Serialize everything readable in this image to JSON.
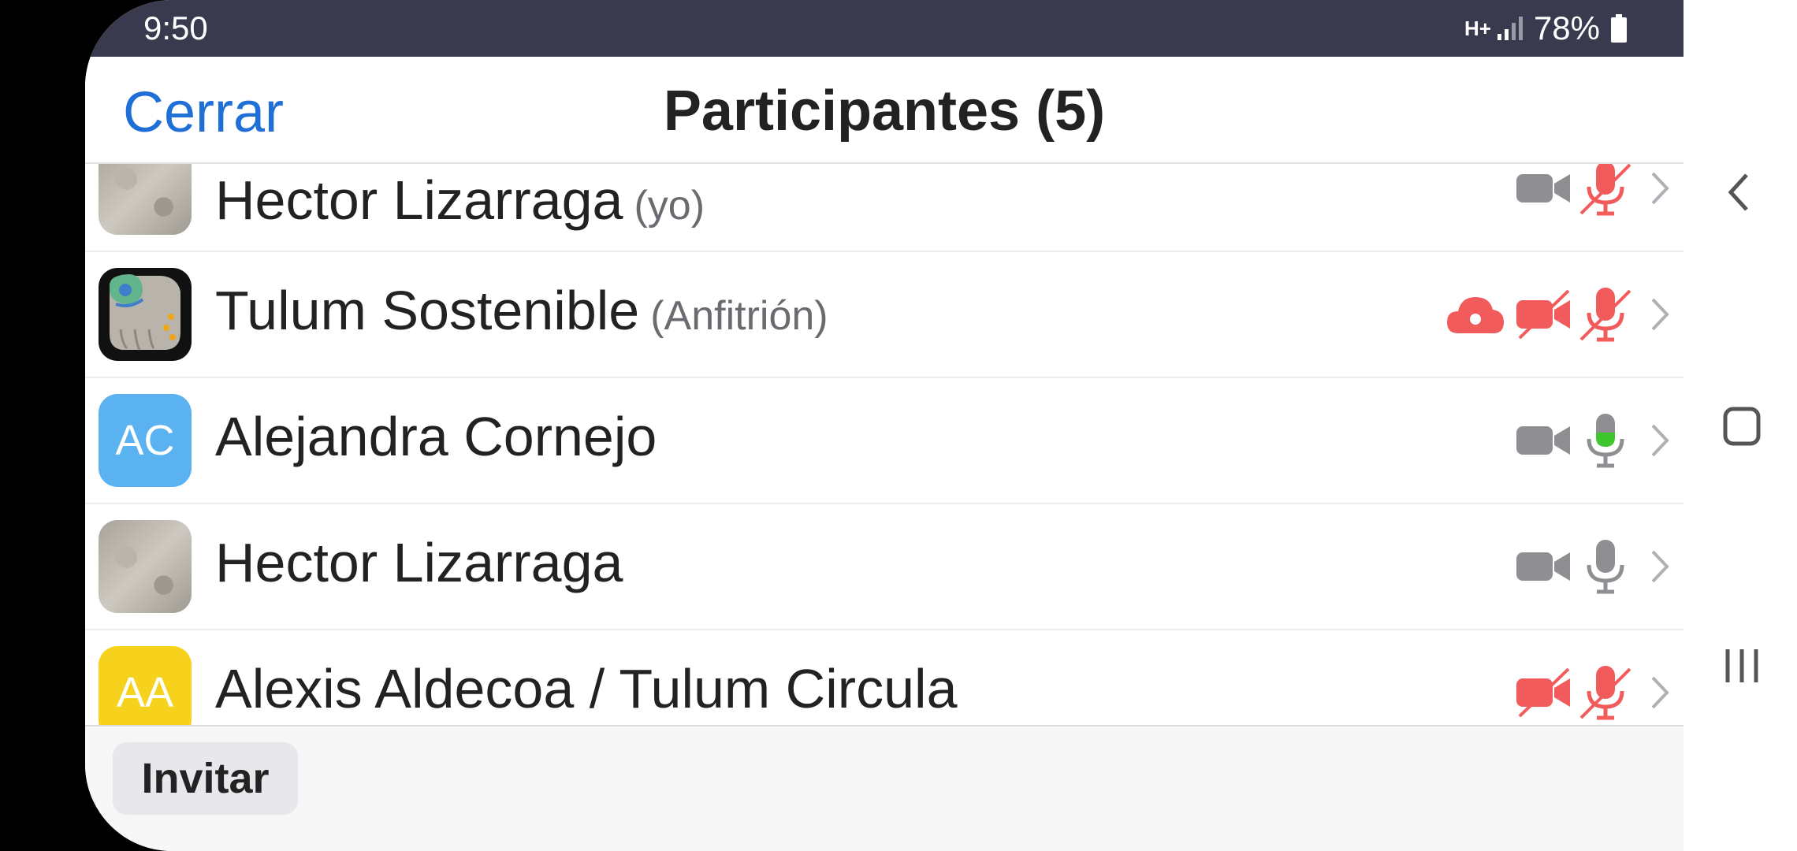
{
  "status_bar": {
    "time": "9:50",
    "network": "H+",
    "battery_percent": "78%"
  },
  "header": {
    "close_label": "Cerrar",
    "title": "Participantes (5)"
  },
  "participants": [
    {
      "name": "Hector Lizarraga",
      "role": "(yo)",
      "avatar": "sand-photo",
      "cloud": false,
      "video": "on-gray",
      "mic": "muted"
    },
    {
      "name": "Tulum Sostenible",
      "role": "(Anfitrión)",
      "avatar": "logo",
      "cloud": true,
      "video": "off",
      "mic": "muted"
    },
    {
      "name": "Alejandra Cornejo",
      "role": "",
      "avatar": "initials",
      "initials": "AC",
      "avatar_color": "#5ab3f0",
      "cloud": false,
      "video": "on-gray",
      "mic": "speaking"
    },
    {
      "name": "Hector Lizarraga",
      "role": "",
      "avatar": "sand-photo",
      "cloud": false,
      "video": "on-gray",
      "mic": "on"
    },
    {
      "name": "Alexis Aldecoa / Tulum Circula",
      "role": "",
      "avatar": "initials",
      "initials": "AA",
      "avatar_color": "#f7d21c",
      "cloud": false,
      "video": "off",
      "mic": "muted"
    }
  ],
  "footer": {
    "invite_label": "Invitar"
  },
  "colors": {
    "accent": "#1f6fd6",
    "muted_red": "#f25b5b",
    "icon_gray": "#8e8e93",
    "speaking_green": "#3fc52d"
  },
  "icons": [
    "chevron-right-icon",
    "video-camera-icon",
    "microphone-icon",
    "cloud-recording-icon",
    "back-icon",
    "home-icon",
    "recents-icon"
  ]
}
